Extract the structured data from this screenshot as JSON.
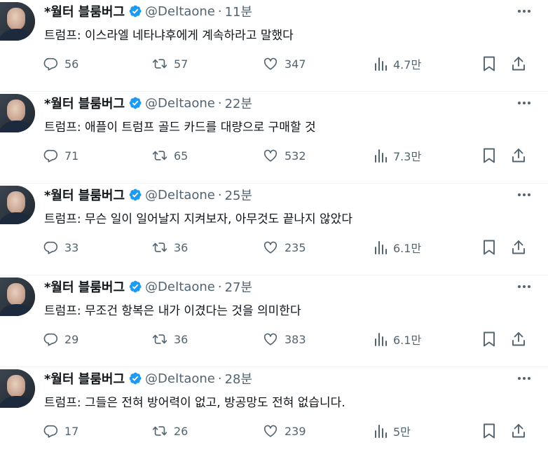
{
  "colors": {
    "verified": "#1d9bf0",
    "muted": "#536471",
    "text": "#0f1419"
  },
  "icons": {
    "reply": "reply-icon",
    "retweet": "retweet-icon",
    "like": "heart-icon",
    "views": "views-icon",
    "bookmark": "bookmark-icon",
    "share": "share-icon",
    "more": "more-icon",
    "verified": "verified-badge-icon"
  },
  "tweets": [
    {
      "name": "*월터 블룸버그",
      "handle": "@DeItaone",
      "separator": "·",
      "time": "11분",
      "text": "트럼프: 이스라엘 네타냐후에게 계속하라고 말했다",
      "replies": "56",
      "retweets": "57",
      "likes": "347",
      "views": "4.7만"
    },
    {
      "name": "*월터 블룸버그",
      "handle": "@DeItaone",
      "separator": "·",
      "time": "22분",
      "text": "트럼프: 애플이 트럼프 골드 카드를 대량으로 구매할 것",
      "replies": "71",
      "retweets": "65",
      "likes": "532",
      "views": "7.3만"
    },
    {
      "name": "*월터 블룸버그",
      "handle": "@DeItaone",
      "separator": "·",
      "time": "25분",
      "text": "트럼프: 무슨 일이 일어날지 지켜보자, 아무것도 끝나지 않았다",
      "replies": "33",
      "retweets": "36",
      "likes": "235",
      "views": "6.1만"
    },
    {
      "name": "*월터 블룸버그",
      "handle": "@DeItaone",
      "separator": "·",
      "time": "27분",
      "text": "트럼프: 무조건 항복은 내가 이겼다는 것을 의미한다",
      "replies": "29",
      "retweets": "36",
      "likes": "383",
      "views": "6.1만"
    },
    {
      "name": "*월터 블룸버그",
      "handle": "@DeItaone",
      "separator": "·",
      "time": "28분",
      "text": "트럼프: 그들은 전혀 방어력이 없고, 방공망도 전혀 없습니다.",
      "replies": "17",
      "retweets": "26",
      "likes": "239",
      "views": "5만"
    }
  ]
}
